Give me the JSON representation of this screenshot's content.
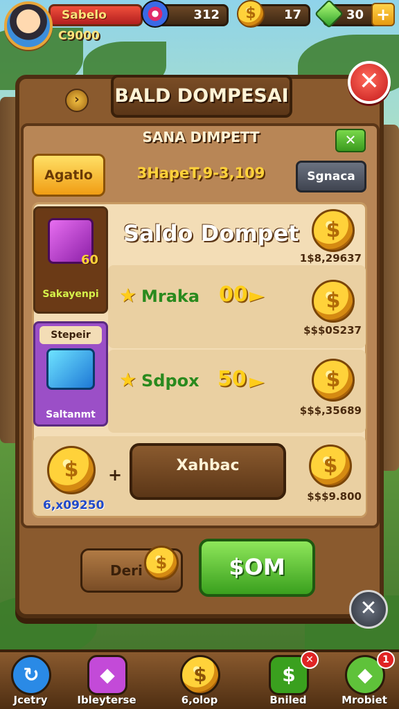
{
  "player": {
    "name": "Sabelo",
    "level_value": "C9000"
  },
  "resources": [
    {
      "id": "target",
      "value": "312"
    },
    {
      "id": "coins",
      "value": "17"
    },
    {
      "id": "gems",
      "value": "30"
    }
  ],
  "plus_label": "+",
  "dialog": {
    "title": "BALD DOMPESAI",
    "subtitle": "SANA DIMPETT",
    "close_glyph": "✕",
    "small_close_glyph": "✕",
    "left_button": "Agatlo",
    "balance_text": "3HapeT,9-3,109",
    "right_button": "Sgnaca",
    "heading": "Saldo Dompet",
    "card1": {
      "label": "Sakayenpi",
      "badge": "60"
    },
    "card2": {
      "top_label": "Stepeir",
      "label": "Saltanmt"
    },
    "row1": {
      "text": "Mraka",
      "amount": "00",
      "price": "1$8,29637"
    },
    "row2": {
      "price": "$$$0S237"
    },
    "row3": {
      "text": "Sdpox",
      "amount": "50",
      "price": "$$$,35689"
    },
    "row4": {
      "button": "Xahbac",
      "blue_amount": "6,x09250",
      "price": "$$$9.800"
    },
    "footer_left": "Deri",
    "footer_green": "$OM",
    "bottom_close_glyph": "✕"
  },
  "bottom_nav": [
    {
      "label": "Jcetry",
      "icon": "refresh-icon",
      "glyph": "↻",
      "color": "#2a8ae6"
    },
    {
      "label": "Ibleyterse",
      "icon": "card-icon",
      "glyph": "◆",
      "color": "#c34ad8"
    },
    {
      "label": "6,olop",
      "icon": "coin-icon",
      "glyph": "$",
      "color": "#f0b41a"
    },
    {
      "label": "Bniled",
      "icon": "ticket-icon",
      "glyph": "$",
      "color": "#3aa01e",
      "badge": "✕"
    },
    {
      "label": "Mrobiet",
      "icon": "gem-icon",
      "glyph": "◆",
      "color": "#5fc23a",
      "badge": "1"
    }
  ]
}
